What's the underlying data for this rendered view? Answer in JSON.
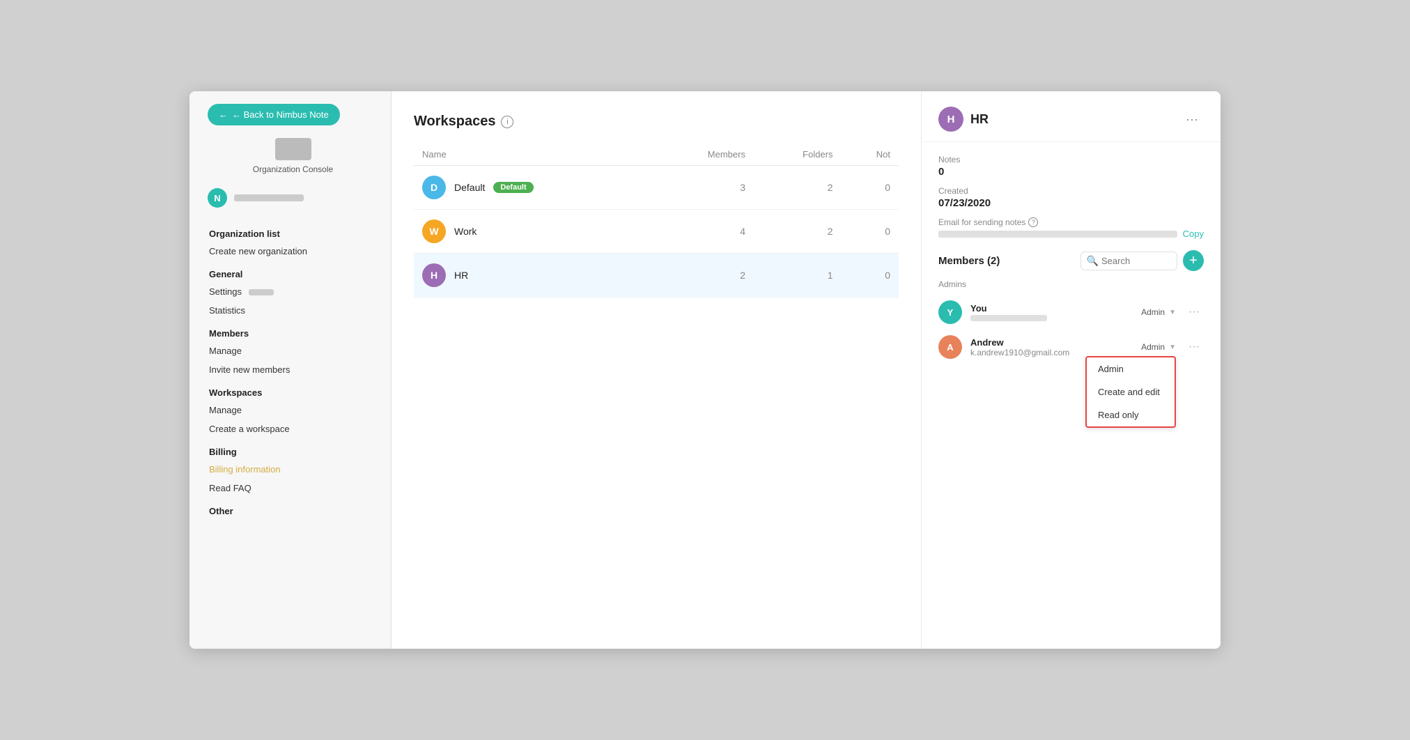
{
  "sidebar": {
    "back_btn": "← Back to Nimbus Note",
    "org_console": "Organization Console",
    "user_initial": "N",
    "nav_sections": [
      {
        "title": "Organization list",
        "items": [
          {
            "label": "Create new organization",
            "id": "create-new-org"
          }
        ]
      },
      {
        "title": "General",
        "items": [
          {
            "label": "Settings",
            "id": "settings"
          },
          {
            "label": "Statistics",
            "id": "statistics"
          }
        ]
      },
      {
        "title": "Members",
        "items": [
          {
            "label": "Manage",
            "id": "members-manage"
          },
          {
            "label": "Invite new members",
            "id": "invite-members"
          }
        ]
      },
      {
        "title": "Workspaces",
        "items": [
          {
            "label": "Manage",
            "id": "workspaces-manage"
          },
          {
            "label": "Create a workspace",
            "id": "create-workspace"
          }
        ]
      },
      {
        "title": "Billing",
        "items": [
          {
            "label": "Billing information",
            "id": "billing-info",
            "class": "billing-link"
          },
          {
            "label": "Read FAQ",
            "id": "read-faq"
          }
        ]
      },
      {
        "title": "Other",
        "items": []
      }
    ]
  },
  "main": {
    "title": "Workspaces",
    "columns": [
      "Name",
      "Members",
      "Folders",
      "Not"
    ],
    "rows": [
      {
        "initial": "D",
        "color": "#4ab8e8",
        "name": "Default",
        "badge": "Default",
        "members": 3,
        "folders": 2,
        "not": 0
      },
      {
        "initial": "W",
        "color": "#f5a623",
        "name": "Work",
        "badge": "",
        "members": 4,
        "folders": 2,
        "not": 0
      },
      {
        "initial": "H",
        "color": "#9c6db5",
        "name": "HR",
        "badge": "",
        "members": 2,
        "folders": 1,
        "not": 0
      }
    ]
  },
  "right_panel": {
    "workspace_initial": "H",
    "workspace_color": "#9c6db5",
    "workspace_name": "HR",
    "notes_label": "Notes",
    "notes_value": "0",
    "created_label": "Created",
    "created_value": "07/23/2020",
    "email_label": "Email for sending notes",
    "copy_label": "Copy",
    "members_title": "Members (2)",
    "search_placeholder": "Search",
    "admins_label": "Admins",
    "members": [
      {
        "id": "you",
        "initial": "Y",
        "color": "#2bbcb0",
        "name": "You",
        "email": "",
        "role": "Admin",
        "show_name_bar": true
      },
      {
        "id": "andrew",
        "initial": "A",
        "color": "#e8825a",
        "name": "Andrew",
        "email": "k.andrew1910@gmail.com",
        "role": "Admin",
        "show_name_bar": false
      }
    ],
    "role_dropdown": {
      "visible": true,
      "options": [
        "Admin",
        "Create and edit",
        "Read only"
      ]
    }
  }
}
